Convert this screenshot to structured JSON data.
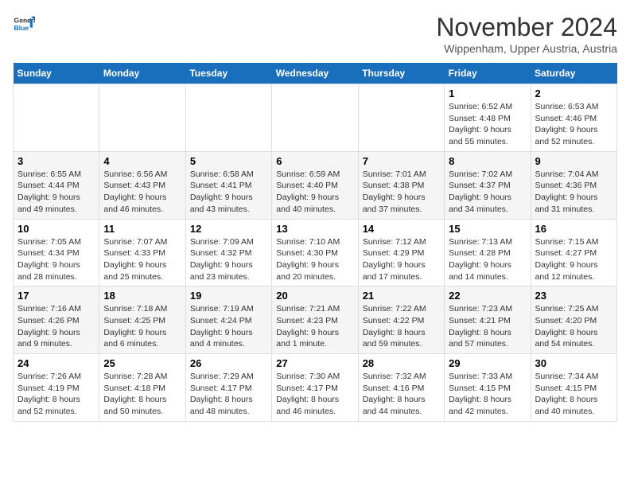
{
  "logo": {
    "line1": "General",
    "line2": "Blue"
  },
  "title": "November 2024",
  "location": "Wippenham, Upper Austria, Austria",
  "weekdays": [
    "Sunday",
    "Monday",
    "Tuesday",
    "Wednesday",
    "Thursday",
    "Friday",
    "Saturday"
  ],
  "weeks": [
    [
      {
        "day": "",
        "info": ""
      },
      {
        "day": "",
        "info": ""
      },
      {
        "day": "",
        "info": ""
      },
      {
        "day": "",
        "info": ""
      },
      {
        "day": "",
        "info": ""
      },
      {
        "day": "1",
        "info": "Sunrise: 6:52 AM\nSunset: 4:48 PM\nDaylight: 9 hours and 55 minutes."
      },
      {
        "day": "2",
        "info": "Sunrise: 6:53 AM\nSunset: 4:46 PM\nDaylight: 9 hours and 52 minutes."
      }
    ],
    [
      {
        "day": "3",
        "info": "Sunrise: 6:55 AM\nSunset: 4:44 PM\nDaylight: 9 hours and 49 minutes."
      },
      {
        "day": "4",
        "info": "Sunrise: 6:56 AM\nSunset: 4:43 PM\nDaylight: 9 hours and 46 minutes."
      },
      {
        "day": "5",
        "info": "Sunrise: 6:58 AM\nSunset: 4:41 PM\nDaylight: 9 hours and 43 minutes."
      },
      {
        "day": "6",
        "info": "Sunrise: 6:59 AM\nSunset: 4:40 PM\nDaylight: 9 hours and 40 minutes."
      },
      {
        "day": "7",
        "info": "Sunrise: 7:01 AM\nSunset: 4:38 PM\nDaylight: 9 hours and 37 minutes."
      },
      {
        "day": "8",
        "info": "Sunrise: 7:02 AM\nSunset: 4:37 PM\nDaylight: 9 hours and 34 minutes."
      },
      {
        "day": "9",
        "info": "Sunrise: 7:04 AM\nSunset: 4:36 PM\nDaylight: 9 hours and 31 minutes."
      }
    ],
    [
      {
        "day": "10",
        "info": "Sunrise: 7:05 AM\nSunset: 4:34 PM\nDaylight: 9 hours and 28 minutes."
      },
      {
        "day": "11",
        "info": "Sunrise: 7:07 AM\nSunset: 4:33 PM\nDaylight: 9 hours and 25 minutes."
      },
      {
        "day": "12",
        "info": "Sunrise: 7:09 AM\nSunset: 4:32 PM\nDaylight: 9 hours and 23 minutes."
      },
      {
        "day": "13",
        "info": "Sunrise: 7:10 AM\nSunset: 4:30 PM\nDaylight: 9 hours and 20 minutes."
      },
      {
        "day": "14",
        "info": "Sunrise: 7:12 AM\nSunset: 4:29 PM\nDaylight: 9 hours and 17 minutes."
      },
      {
        "day": "15",
        "info": "Sunrise: 7:13 AM\nSunset: 4:28 PM\nDaylight: 9 hours and 14 minutes."
      },
      {
        "day": "16",
        "info": "Sunrise: 7:15 AM\nSunset: 4:27 PM\nDaylight: 9 hours and 12 minutes."
      }
    ],
    [
      {
        "day": "17",
        "info": "Sunrise: 7:16 AM\nSunset: 4:26 PM\nDaylight: 9 hours and 9 minutes."
      },
      {
        "day": "18",
        "info": "Sunrise: 7:18 AM\nSunset: 4:25 PM\nDaylight: 9 hours and 6 minutes."
      },
      {
        "day": "19",
        "info": "Sunrise: 7:19 AM\nSunset: 4:24 PM\nDaylight: 9 hours and 4 minutes."
      },
      {
        "day": "20",
        "info": "Sunrise: 7:21 AM\nSunset: 4:23 PM\nDaylight: 9 hours and 1 minute."
      },
      {
        "day": "21",
        "info": "Sunrise: 7:22 AM\nSunset: 4:22 PM\nDaylight: 8 hours and 59 minutes."
      },
      {
        "day": "22",
        "info": "Sunrise: 7:23 AM\nSunset: 4:21 PM\nDaylight: 8 hours and 57 minutes."
      },
      {
        "day": "23",
        "info": "Sunrise: 7:25 AM\nSunset: 4:20 PM\nDaylight: 8 hours and 54 minutes."
      }
    ],
    [
      {
        "day": "24",
        "info": "Sunrise: 7:26 AM\nSunset: 4:19 PM\nDaylight: 8 hours and 52 minutes."
      },
      {
        "day": "25",
        "info": "Sunrise: 7:28 AM\nSunset: 4:18 PM\nDaylight: 8 hours and 50 minutes."
      },
      {
        "day": "26",
        "info": "Sunrise: 7:29 AM\nSunset: 4:17 PM\nDaylight: 8 hours and 48 minutes."
      },
      {
        "day": "27",
        "info": "Sunrise: 7:30 AM\nSunset: 4:17 PM\nDaylight: 8 hours and 46 minutes."
      },
      {
        "day": "28",
        "info": "Sunrise: 7:32 AM\nSunset: 4:16 PM\nDaylight: 8 hours and 44 minutes."
      },
      {
        "day": "29",
        "info": "Sunrise: 7:33 AM\nSunset: 4:15 PM\nDaylight: 8 hours and 42 minutes."
      },
      {
        "day": "30",
        "info": "Sunrise: 7:34 AM\nSunset: 4:15 PM\nDaylight: 8 hours and 40 minutes."
      }
    ]
  ]
}
